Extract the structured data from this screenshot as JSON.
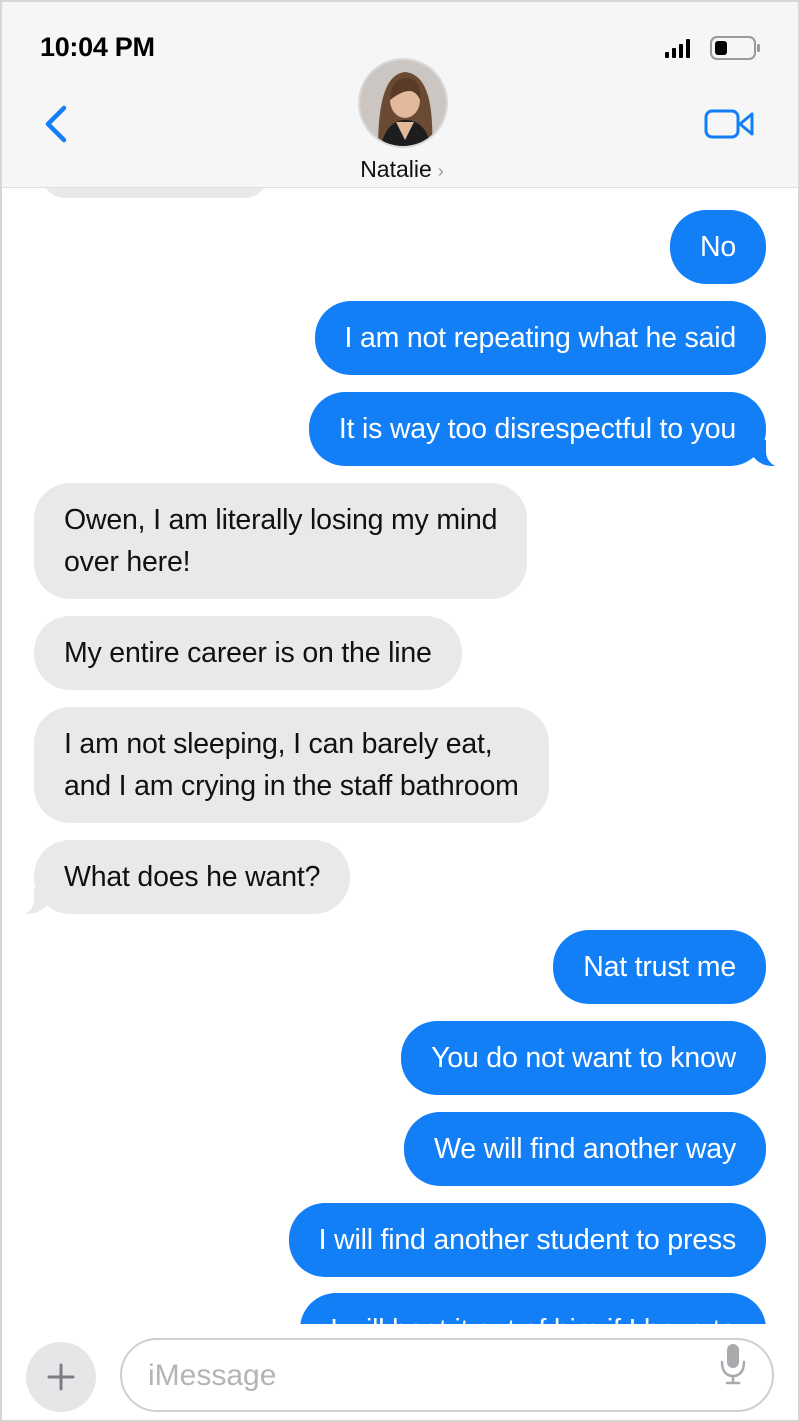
{
  "status_bar": {
    "time": "10:04 PM"
  },
  "header": {
    "contact_name": "Natalie",
    "chevron": "›"
  },
  "messages": [
    {
      "text": "No"
    },
    {
      "text": "I am not repeating what he said"
    },
    {
      "text": "It is way too disrespectful to you"
    },
    {
      "line1": "Owen, I am literally losing my mind",
      "line2": "over here!"
    },
    {
      "text": "My entire career is on the line"
    },
    {
      "line1": "I am not sleeping, I can barely eat,",
      "line2": "and I am crying in the staff bathroom"
    },
    {
      "text": "What does he want?"
    },
    {
      "text": "Nat trust me"
    },
    {
      "text": "You do not want to know"
    },
    {
      "text": "We will find another way"
    },
    {
      "text": "I will find another student to press"
    },
    {
      "text": "I will beat it out of him if I have to"
    }
  ],
  "input": {
    "placeholder": "iMessage",
    "plus_label": "+"
  },
  "colors": {
    "sent": "#127ff6",
    "received": "#e9e9eb",
    "accent": "#127ff6"
  },
  "icons": [
    "back-chevron-icon",
    "video-camera-icon",
    "signal-icon",
    "battery-icon",
    "plus-icon",
    "microphone-icon"
  ]
}
